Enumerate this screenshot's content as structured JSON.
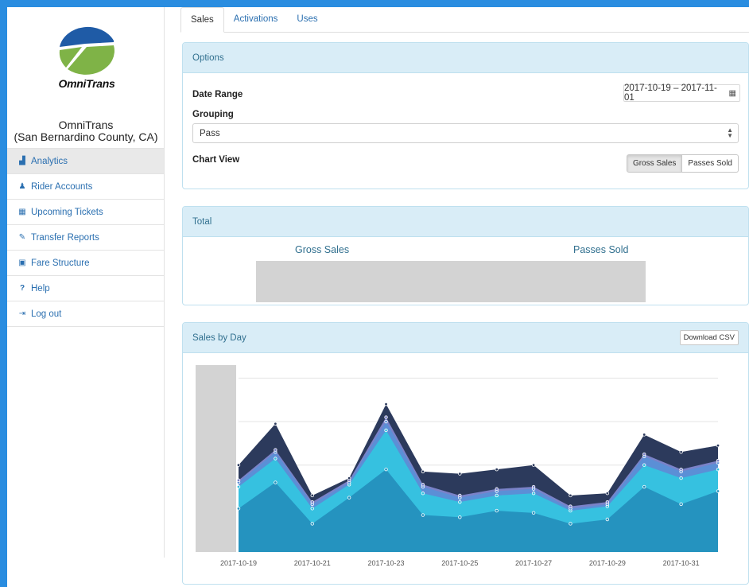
{
  "sidebar": {
    "logo_text": "OmniTrans",
    "org_name_line1": "OmniTrans",
    "org_name_line2": "(San Bernardino County, CA)",
    "items": [
      {
        "label": "Analytics",
        "icon": "chart-area-icon",
        "glyph": "▟"
      },
      {
        "label": "Rider Accounts",
        "icon": "user-icon",
        "glyph": "♟"
      },
      {
        "label": "Upcoming Tickets",
        "icon": "calendar-icon",
        "glyph": "▦"
      },
      {
        "label": "Transfer Reports",
        "icon": "edit-icon",
        "glyph": "✎"
      },
      {
        "label": "Fare Structure",
        "icon": "bus-icon",
        "glyph": "▣"
      },
      {
        "label": "Help",
        "icon": "question-icon",
        "glyph": "?"
      },
      {
        "label": "Log out",
        "icon": "sign-out-icon",
        "glyph": "⇥"
      }
    ],
    "active_index": 0
  },
  "tabs": [
    {
      "label": "Sales",
      "active": true
    },
    {
      "label": "Activations",
      "active": false
    },
    {
      "label": "Uses",
      "active": false
    }
  ],
  "options": {
    "title": "Options",
    "date_range_label": "Date Range",
    "date_range_value": "2017-10-19 – 2017-11-01",
    "grouping_label": "Grouping",
    "grouping_value": "Pass",
    "chart_view_label": "Chart View",
    "chart_view_buttons": [
      "Gross Sales",
      "Passes Sold"
    ],
    "chart_view_selected": "Gross Sales"
  },
  "total": {
    "title": "Total",
    "gross_sales_label": "Gross Sales",
    "passes_sold_label": "Passes Sold"
  },
  "sales_by_day": {
    "title": "Sales by Day",
    "download_label": "Download CSV"
  },
  "colors": {
    "accent": "#2a6fb0",
    "panel_header": "#d9edf7",
    "series": [
      "#2593bf",
      "#36c1e0",
      "#5b8fd6",
      "#7a82c8",
      "#2c3a5c"
    ]
  },
  "chart_data": {
    "type": "area",
    "stacked": true,
    "x_tick_labels": [
      "2017-10-19",
      "2017-10-21",
      "2017-10-23",
      "2017-10-25",
      "2017-10-27",
      "2017-10-29",
      "2017-10-31"
    ],
    "x": [
      "2017-10-19",
      "2017-10-20",
      "2017-10-21",
      "2017-10-22",
      "2017-10-23",
      "2017-10-24",
      "2017-10-25",
      "2017-10-26",
      "2017-10-27",
      "2017-10-28",
      "2017-10-29",
      "2017-10-30",
      "2017-10-31",
      "2017-11-01"
    ],
    "y_tick_values": [
      0,
      1,
      2,
      3,
      4
    ],
    "ylim": [
      0,
      4.3
    ],
    "grid": true,
    "series": [
      {
        "values": [
          1.0,
          1.6,
          0.65,
          1.25,
          1.9,
          0.85,
          0.8,
          0.95,
          0.9,
          0.65,
          0.75,
          1.5,
          1.1,
          1.4
        ]
      },
      {
        "values": [
          0.5,
          0.55,
          0.35,
          0.3,
          0.9,
          0.5,
          0.35,
          0.35,
          0.45,
          0.3,
          0.3,
          0.5,
          0.6,
          0.5
        ]
      },
      {
        "values": [
          0.1,
          0.15,
          0.1,
          0.05,
          0.2,
          0.15,
          0.1,
          0.1,
          0.1,
          0.05,
          0.05,
          0.2,
          0.15,
          0.15
        ]
      },
      {
        "values": [
          0.05,
          0.05,
          0.05,
          0.05,
          0.1,
          0.05,
          0.05,
          0.05,
          0.05,
          0.05,
          0.05,
          0.05,
          0.05,
          0.05
        ]
      },
      {
        "values": [
          0.35,
          0.6,
          0.15,
          0.05,
          0.3,
          0.3,
          0.5,
          0.45,
          0.5,
          0.25,
          0.2,
          0.45,
          0.4,
          0.35
        ]
      }
    ]
  }
}
